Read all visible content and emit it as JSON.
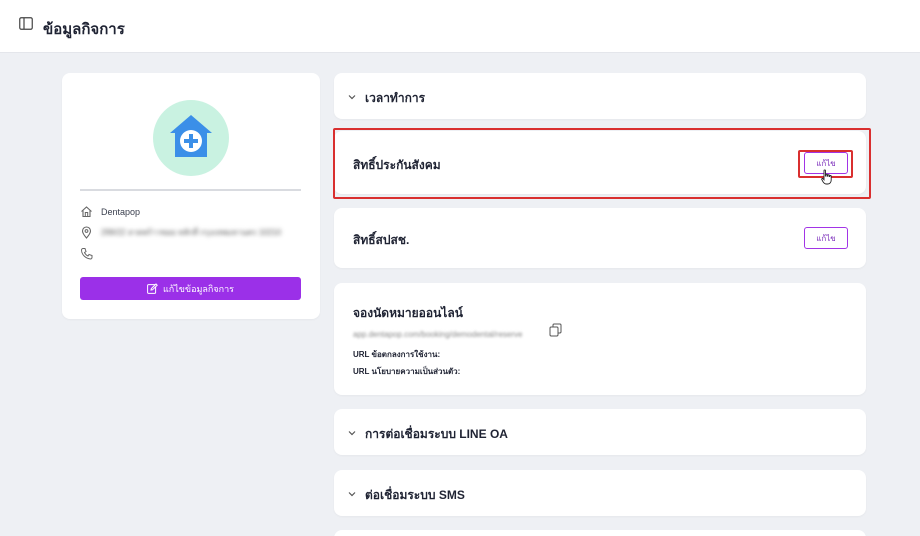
{
  "header": {
    "title": "ข้อมูลกิจการ",
    "icon": "sidebar-panel-icon"
  },
  "profile": {
    "avatar_icon": "clinic-house-plus-icon",
    "name": "Dentapop",
    "address": "299/22 ลาดพร้าวซอย หลักสี่ กรุงเทพมหานคร 10210",
    "phone": "",
    "edit_button": "แก้ไขข้อมูลกิจการ"
  },
  "sections": {
    "hours": {
      "title": "เวลาทำการ"
    },
    "social_security": {
      "title": "สิทธิ์ประกันสังคม",
      "button": "แก้ไข"
    },
    "nhso": {
      "title": "สิทธิ์สปสช.",
      "button": "แก้ไข"
    },
    "booking": {
      "title": "จองนัดหมายออนไลน์",
      "link": "app.dentapop.com/booking/demodental/reserve",
      "terms_label": "URL ข้อตกลงการใช้งาน:",
      "privacy_label": "URL นโยบายความเป็นส่วนตัว:"
    },
    "line_oa": {
      "title": "การต่อเชื่อมระบบ LINE OA"
    },
    "sms": {
      "title": "ต่อเชื่อมระบบ SMS"
    }
  },
  "colors": {
    "accent": "#9b30e8",
    "highlight": "#d92f2f",
    "avatar_bg": "#c9f2e1",
    "avatar_icon": "#3b8fe8"
  }
}
